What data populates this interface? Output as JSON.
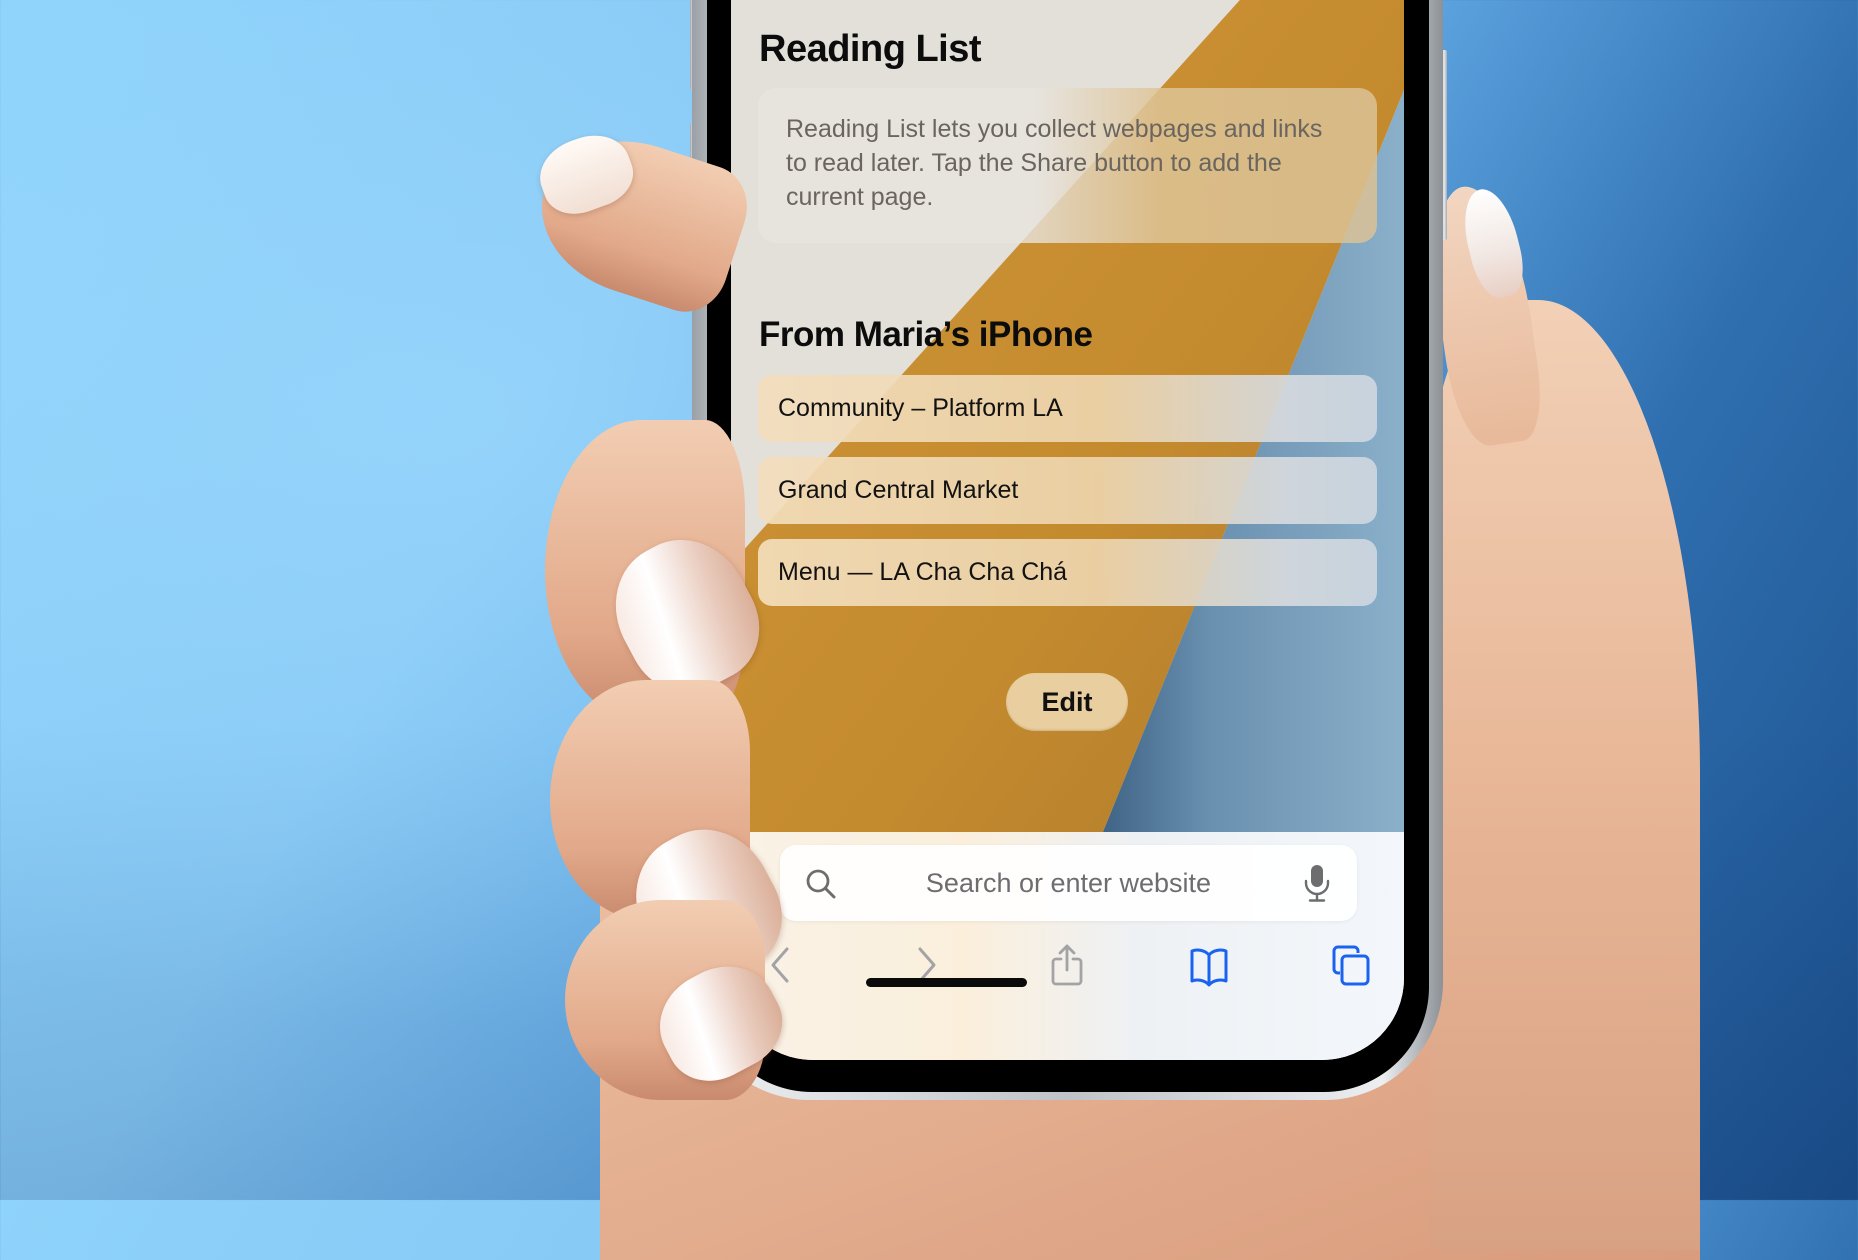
{
  "reading_list": {
    "title": "Reading List",
    "info": "Reading List lets you collect webpages and links to read later. Tap the Share button to add the current page."
  },
  "device_section": {
    "title": "From Maria’s iPhone",
    "items": [
      {
        "label": "Community – Platform LA"
      },
      {
        "label": "Grand Central Market"
      },
      {
        "label": "Menu — LA Cha Cha Chá"
      }
    ]
  },
  "edit_label": "Edit",
  "toolbar": {
    "search_placeholder": "Search or enter website",
    "search_value": "",
    "icons": [
      "search-icon",
      "microphone-icon",
      "back-chevron-icon",
      "forward-chevron-icon",
      "share-icon",
      "bookmarks-book-icon",
      "tabs-icon"
    ]
  },
  "colors": {
    "accent_blue": "#1a63f0",
    "disabled_gray": "#a3a3a6",
    "wallpaper_cream": "#e3dfd9",
    "wallpaper_gold": "#c98f31",
    "wallpaper_blue": "#7ea3bf",
    "edit_button": "#e9cf9f"
  }
}
